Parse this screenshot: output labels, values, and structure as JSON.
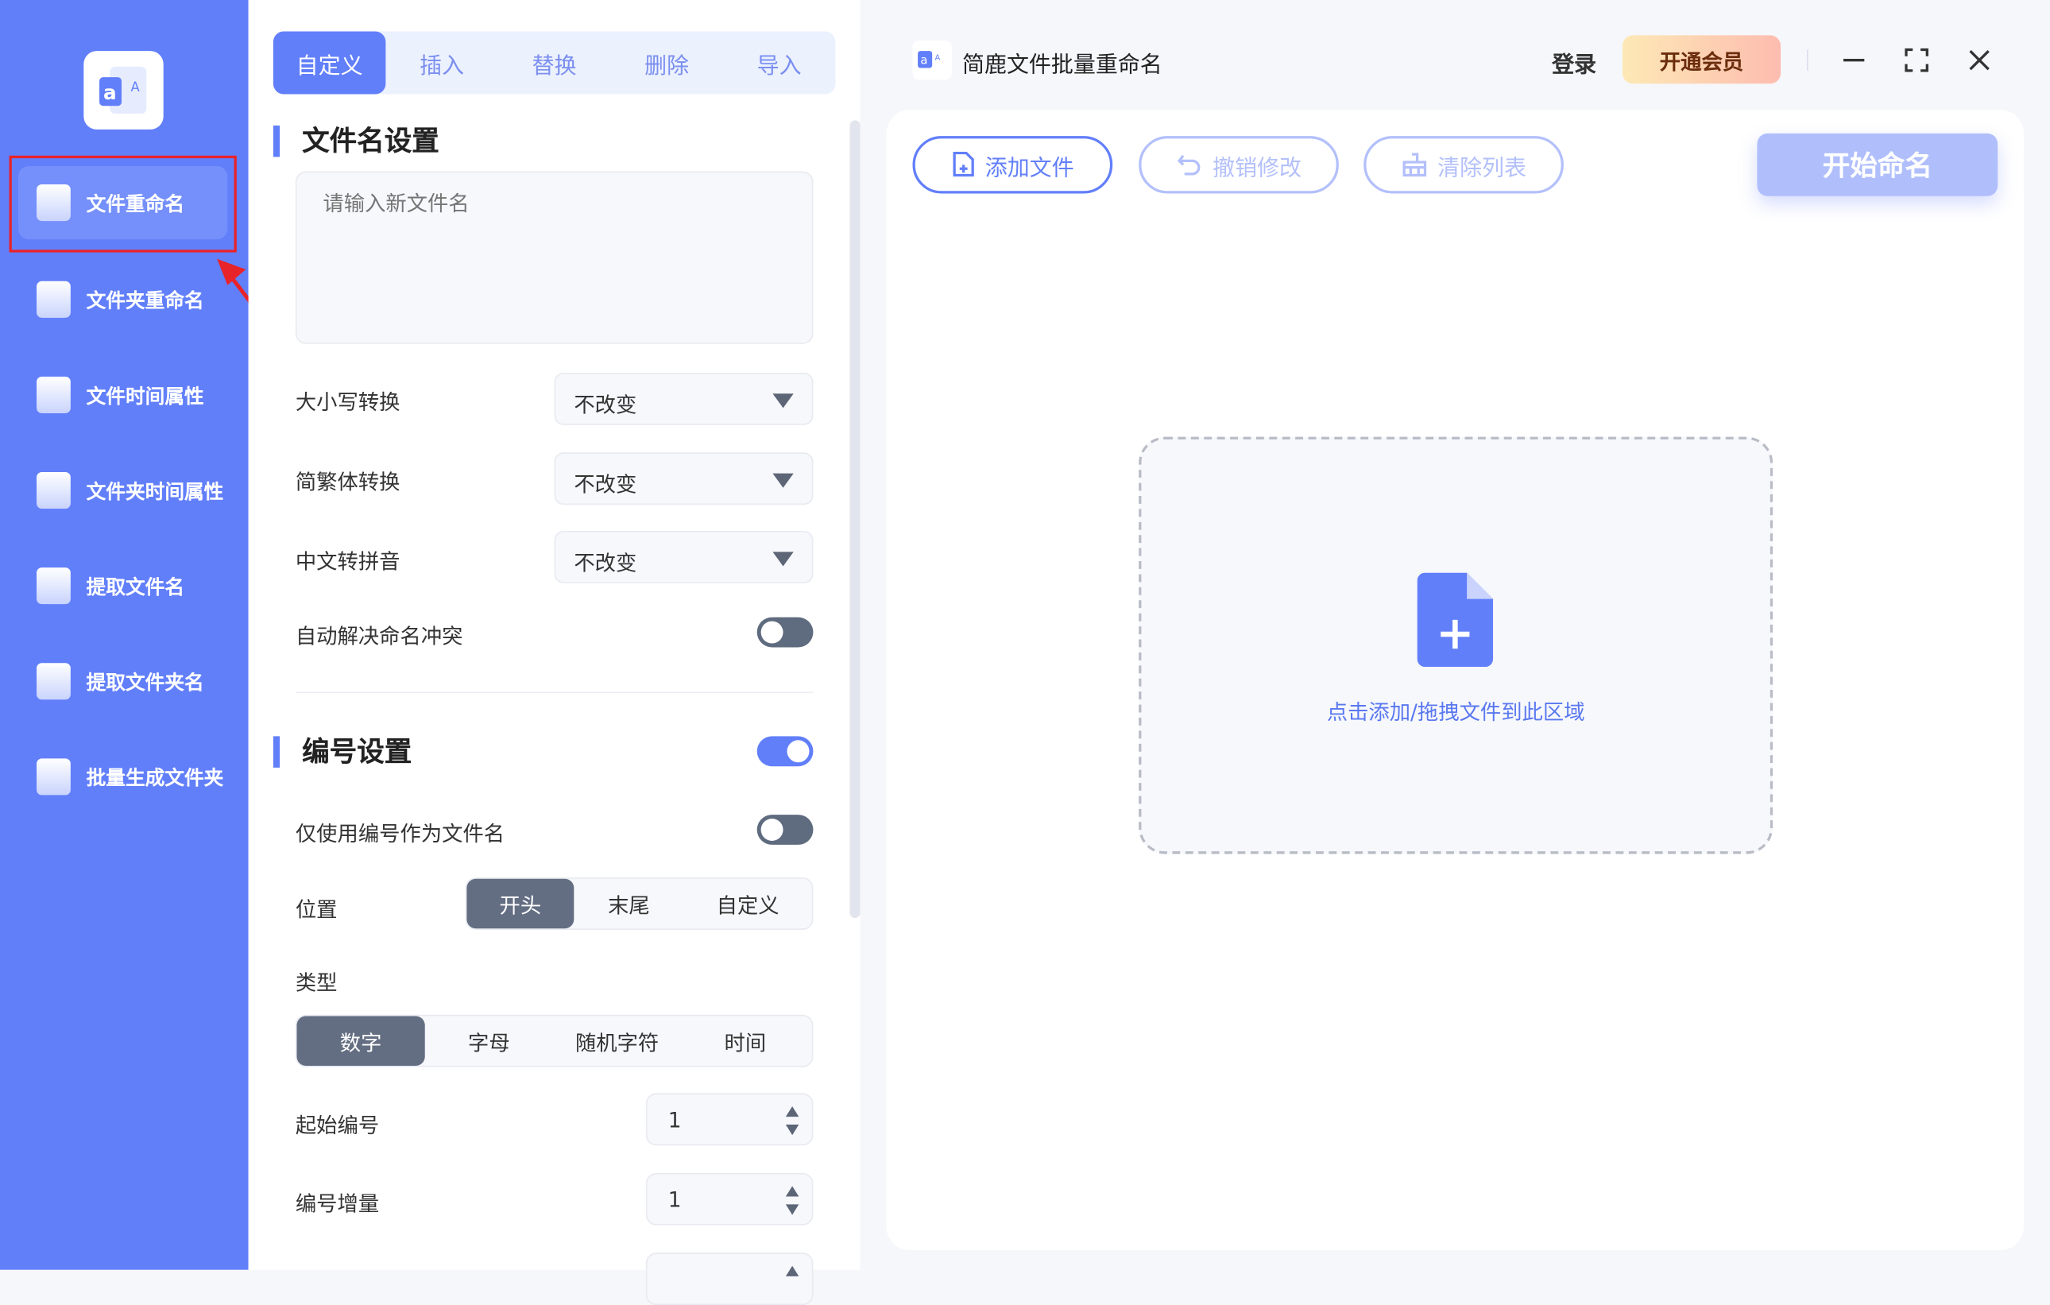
{
  "app": {
    "title": "简鹿文件批量重命名",
    "login": "登录",
    "vip": "开通会员"
  },
  "sidebar": {
    "items": [
      {
        "label": "文件重命名",
        "icon": "file-icon"
      },
      {
        "label": "文件夹重命名",
        "icon": "folder-icon"
      },
      {
        "label": "文件时间属性",
        "icon": "file-clock-icon"
      },
      {
        "label": "文件夹时间属性",
        "icon": "folder-clock-icon"
      },
      {
        "label": "提取文件名",
        "icon": "file-upload-icon"
      },
      {
        "label": "提取文件夹名",
        "icon": "folder-up-icon"
      },
      {
        "label": "批量生成文件夹",
        "icon": "folder-plus-icon"
      }
    ]
  },
  "tabs": [
    "自定义",
    "插入",
    "替换",
    "删除",
    "导入"
  ],
  "filename": {
    "title": "文件名设置",
    "placeholder": "请输入新文件名",
    "case_label": "大小写转换",
    "case_value": "不改变",
    "trad_label": "简繁体转换",
    "trad_value": "不改变",
    "pinyin_label": "中文转拼音",
    "pinyin_value": "不改变",
    "conflict_label": "自动解决命名冲突"
  },
  "numbering": {
    "title": "编号设置",
    "only_label": "仅使用编号作为文件名",
    "position_label": "位置",
    "positions": [
      "开头",
      "末尾",
      "自定义"
    ],
    "type_label": "类型",
    "types": [
      "数字",
      "字母",
      "随机字符",
      "时间"
    ],
    "start_label": "起始编号",
    "start_value": "1",
    "step_label": "编号增量",
    "step_value": "1"
  },
  "toolbar": {
    "add": "添加文件",
    "undo": "撤销修改",
    "clear": "清除列表",
    "start": "开始命名"
  },
  "dropzone": {
    "text": "点击添加/拖拽文件到此区域"
  },
  "colors": {
    "accent": "#627ffa",
    "sidebar": "#627ffa"
  }
}
